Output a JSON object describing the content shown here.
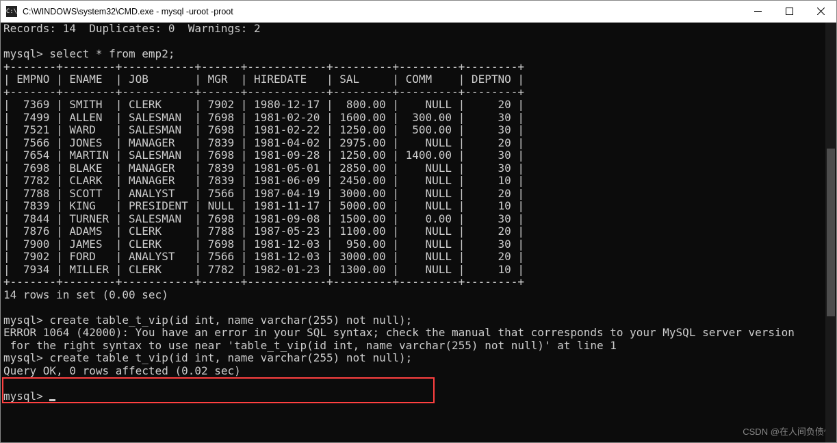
{
  "window": {
    "title": "C:\\WINDOWS\\system32\\CMD.exe - mysql  -uroot -proot",
    "icon_text": "C:\\"
  },
  "term": {
    "records_line": "Records: 14  Duplicates: 0  Warnings: 2",
    "blank": "",
    "prompt1": "mysql> select * from emp2;",
    "hsep": "+-------+--------+-----------+------+------------+---------+---------+--------+",
    "hdr": "| EMPNO | ENAME  | JOB       | MGR  | HIREDATE   | SAL     | COMM    | DEPTNO |",
    "rows": [
      "|  7369 | SMITH  | CLERK     | 7902 | 1980-12-17 |  800.00 |    NULL |     20 |",
      "|  7499 | ALLEN  | SALESMAN  | 7698 | 1981-02-20 | 1600.00 |  300.00 |     30 |",
      "|  7521 | WARD   | SALESMAN  | 7698 | 1981-02-22 | 1250.00 |  500.00 |     30 |",
      "|  7566 | JONES  | MANAGER   | 7839 | 1981-04-02 | 2975.00 |    NULL |     20 |",
      "|  7654 | MARTIN | SALESMAN  | 7698 | 1981-09-28 | 1250.00 | 1400.00 |     30 |",
      "|  7698 | BLAKE  | MANAGER   | 7839 | 1981-05-01 | 2850.00 |    NULL |     30 |",
      "|  7782 | CLARK  | MANAGER   | 7839 | 1981-06-09 | 2450.00 |    NULL |     10 |",
      "|  7788 | SCOTT  | ANALYST   | 7566 | 1987-04-19 | 3000.00 |    NULL |     20 |",
      "|  7839 | KING   | PRESIDENT | NULL | 1981-11-17 | 5000.00 |    NULL |     10 |",
      "|  7844 | TURNER | SALESMAN  | 7698 | 1981-09-08 | 1500.00 |    0.00 |     30 |",
      "|  7876 | ADAMS  | CLERK     | 7788 | 1987-05-23 | 1100.00 |    NULL |     20 |",
      "|  7900 | JAMES  | CLERK     | 7698 | 1981-12-03 |  950.00 |    NULL |     30 |",
      "|  7902 | FORD   | ANALYST   | 7566 | 1981-12-03 | 3000.00 |    NULL |     20 |",
      "|  7934 | MILLER | CLERK     | 7782 | 1982-01-23 | 1300.00 |    NULL |     10 |"
    ],
    "rows_in_set": "14 rows in set (0.00 sec)",
    "prompt2": "mysql> create table_t_vip(id int, name varchar(255) not null);",
    "error1": "ERROR 1064 (42000): You have an error in your SQL syntax; check the manual that corresponds to your MySQL server version",
    "error2": " for the right syntax to use near 'table_t_vip(id int, name varchar(255) not null)' at line 1",
    "prompt3": "mysql> create table t_vip(id int, name varchar(255) not null);",
    "queryok": "Query OK, 0 rows affected (0.02 sec)",
    "prompt4": "mysql> "
  },
  "watermark": "CSDN @在人间负债^",
  "chart_data": {
    "type": "table",
    "title": "emp2",
    "columns": [
      "EMPNO",
      "ENAME",
      "JOB",
      "MGR",
      "HIREDATE",
      "SAL",
      "COMM",
      "DEPTNO"
    ],
    "rows": [
      [
        7369,
        "SMITH",
        "CLERK",
        7902,
        "1980-12-17",
        800.0,
        null,
        20
      ],
      [
        7499,
        "ALLEN",
        "SALESMAN",
        7698,
        "1981-02-20",
        1600.0,
        300.0,
        30
      ],
      [
        7521,
        "WARD",
        "SALESMAN",
        7698,
        "1981-02-22",
        1250.0,
        500.0,
        30
      ],
      [
        7566,
        "JONES",
        "MANAGER",
        7839,
        "1981-04-02",
        2975.0,
        null,
        20
      ],
      [
        7654,
        "MARTIN",
        "SALESMAN",
        7698,
        "1981-09-28",
        1250.0,
        1400.0,
        30
      ],
      [
        7698,
        "BLAKE",
        "MANAGER",
        7839,
        "1981-05-01",
        2850.0,
        null,
        30
      ],
      [
        7782,
        "CLARK",
        "MANAGER",
        7839,
        "1981-06-09",
        2450.0,
        null,
        10
      ],
      [
        7788,
        "SCOTT",
        "ANALYST",
        7566,
        "1987-04-19",
        3000.0,
        null,
        20
      ],
      [
        7839,
        "KING",
        "PRESIDENT",
        null,
        "1981-11-17",
        5000.0,
        null,
        10
      ],
      [
        7844,
        "TURNER",
        "SALESMAN",
        7698,
        "1981-09-08",
        1500.0,
        0.0,
        30
      ],
      [
        7876,
        "ADAMS",
        "CLERK",
        7788,
        "1987-05-23",
        1100.0,
        null,
        20
      ],
      [
        7900,
        "JAMES",
        "CLERK",
        7698,
        "1981-12-03",
        950.0,
        null,
        30
      ],
      [
        7902,
        "FORD",
        "ANALYST",
        7566,
        "1981-12-03",
        3000.0,
        null,
        20
      ],
      [
        7934,
        "MILLER",
        "CLERK",
        7782,
        "1982-01-23",
        1300.0,
        null,
        10
      ]
    ]
  }
}
